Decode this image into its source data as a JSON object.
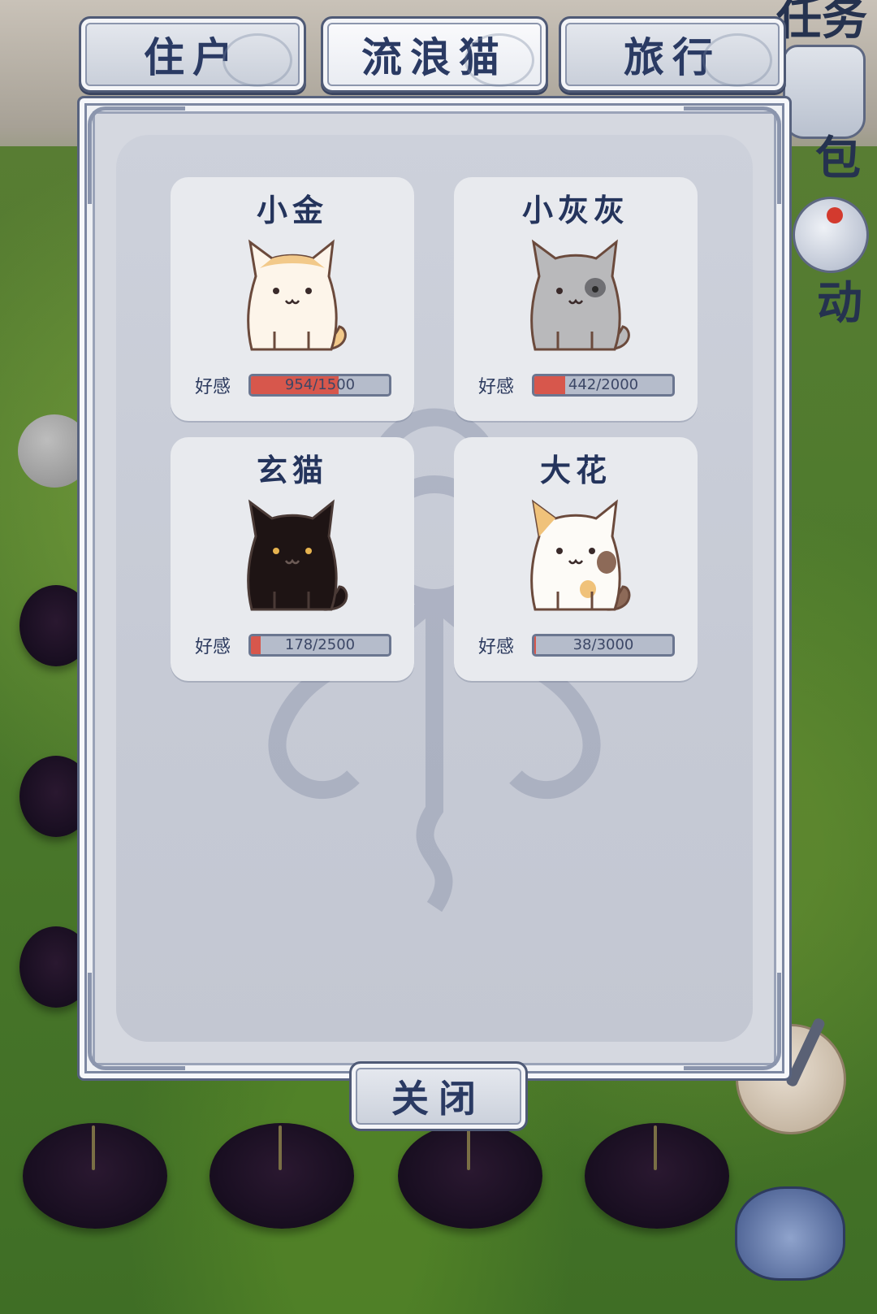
{
  "tabs": [
    {
      "label": "住户",
      "active": false
    },
    {
      "label": "流浪猫",
      "active": true
    },
    {
      "label": "旅行",
      "active": false
    }
  ],
  "side": {
    "quest_label": "任务",
    "bag_label": "包",
    "event_label": "动"
  },
  "affection_label": "好感",
  "cats": [
    {
      "name": "小金",
      "affection": "954/1500",
      "value": 954,
      "max": 1500,
      "icon": "cream-cat"
    },
    {
      "name": "小灰灰",
      "affection": "442/2000",
      "value": 442,
      "max": 2000,
      "icon": "gray-cat"
    },
    {
      "name": "玄猫",
      "affection": "178/2500",
      "value": 178,
      "max": 2500,
      "icon": "black-cat"
    },
    {
      "name": "大花",
      "affection": "38/3000",
      "value": 38,
      "max": 3000,
      "icon": "calico-cat"
    }
  ],
  "close_label": "关闭",
  "colors": {
    "affection_fill": "#d7574c",
    "title_text": "#24345c"
  }
}
